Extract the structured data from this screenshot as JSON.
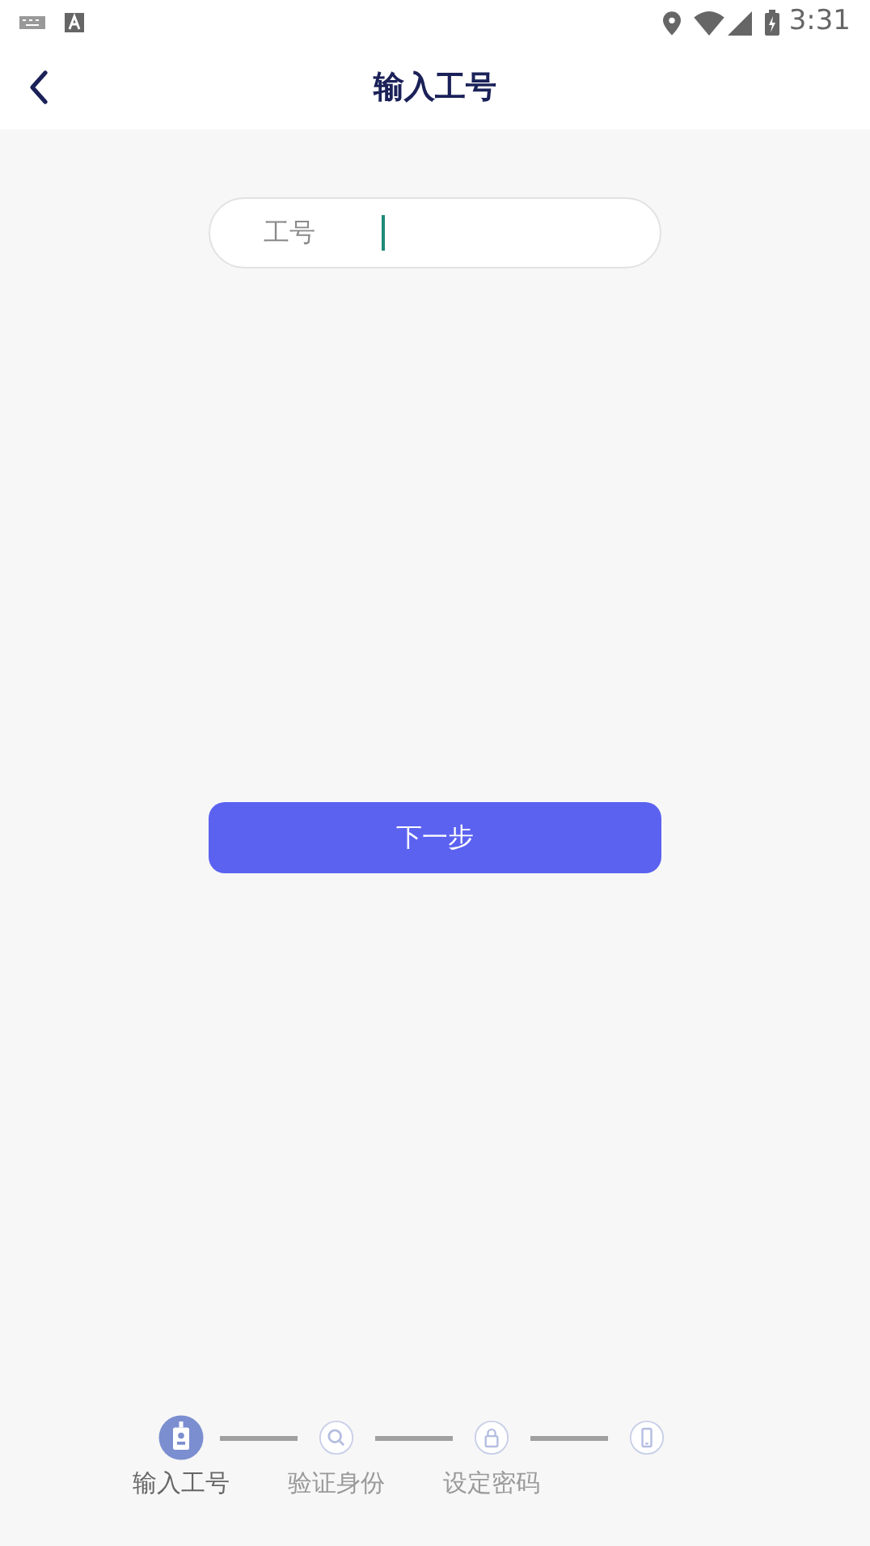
{
  "status_bar": {
    "time": "3:31"
  },
  "header": {
    "title": "输入工号"
  },
  "form": {
    "label": "工号",
    "focused": true
  },
  "next_button": {
    "label": "下一步"
  },
  "steps": [
    {
      "kind": "badge",
      "label": "输入工号",
      "selected": true
    },
    {
      "kind": "search",
      "label": "验证身份",
      "selected": false
    },
    {
      "kind": "lock",
      "label": "设定密码",
      "selected": false
    },
    {
      "kind": "phone",
      "selected": false
    }
  ]
}
